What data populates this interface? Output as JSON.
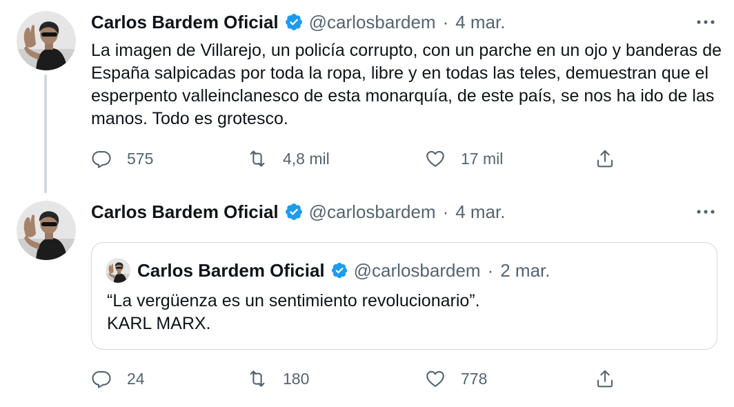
{
  "colors": {
    "text": "#0f1419",
    "secondary": "#536471",
    "verified": "#1d9bf0",
    "border": "#cfd9de"
  },
  "tweets": [
    {
      "author": {
        "name": "Carlos Bardem Oficial",
        "handle": "@carlosbardem",
        "verified": true
      },
      "separator": "·",
      "date": "4 mar.",
      "text": "La imagen de Villarejo, un policía corrupto, con un parche en un ojo y banderas de España salpicadas por toda la ropa, libre y en todas las teles, demuestran que el esperpento valleinclanesco de esta monarquía, de este país, se nos ha ido de las manos. Todo es grotesco.",
      "stats": {
        "replies": "575",
        "retweets": "4,8 mil",
        "likes": "17 mil"
      }
    },
    {
      "author": {
        "name": "Carlos Bardem Oficial",
        "handle": "@carlosbardem",
        "verified": true
      },
      "separator": "·",
      "date": "4 mar.",
      "quoted": {
        "author": {
          "name": "Carlos Bardem Oficial",
          "handle": "@carlosbardem",
          "verified": true
        },
        "separator": "·",
        "date": "2 mar.",
        "line1": "“La vergüenza es un sentimiento revolucionario”.",
        "line2": "KARL MARX."
      },
      "stats": {
        "replies": "24",
        "retweets": "180",
        "likes": "778"
      }
    }
  ],
  "icons": [
    "avatar-photo",
    "verified-badge-icon",
    "more-options-icon",
    "reply-icon",
    "retweet-icon",
    "like-icon",
    "share-icon"
  ]
}
